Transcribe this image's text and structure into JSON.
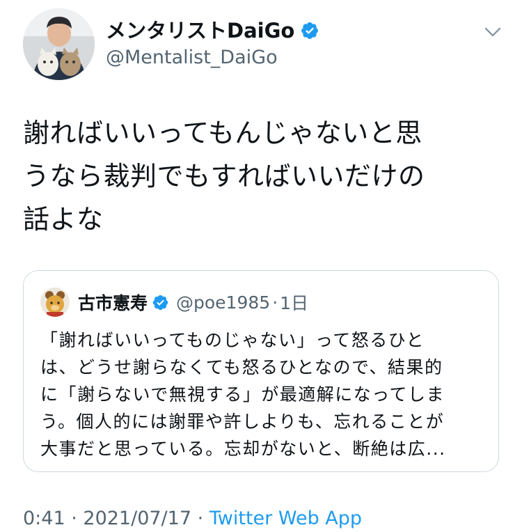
{
  "author": {
    "display_name": "メンタリストDaiGo",
    "handle": "@Mentalist_DaiGo",
    "verified": true
  },
  "tweet": {
    "text": "謝ればいいってもんじゃないと思\nうなら裁判でもすればいいだけの\n話よな"
  },
  "quoted_tweet": {
    "display_name": "古市憲寿",
    "handle": "@poe1985",
    "separator": "·",
    "time": "1日",
    "verified": true,
    "text": "「謝ればいいってものじゃない」って怒るひと\nは、どうせ謝らなくても怒るひとなので、結果的\nに「謝らないで無視する」が最適解になってしま\nう。個人的には謝罪や許しよりも、忘れることが\n大事だと思っている。忘却がないと、断絶は広..."
  },
  "meta": {
    "time": "0:41",
    "separator_1": " · ",
    "date": "2021/07/17",
    "separator_2": " · ",
    "source": "Twitter Web App"
  },
  "icons": {
    "verified": "verified-badge-icon",
    "caret": "chevron-down-icon"
  },
  "colors": {
    "link": "#1d9bf0",
    "secondary_text": "#536471",
    "primary_text": "#0f1419",
    "border": "#cfd9de"
  }
}
